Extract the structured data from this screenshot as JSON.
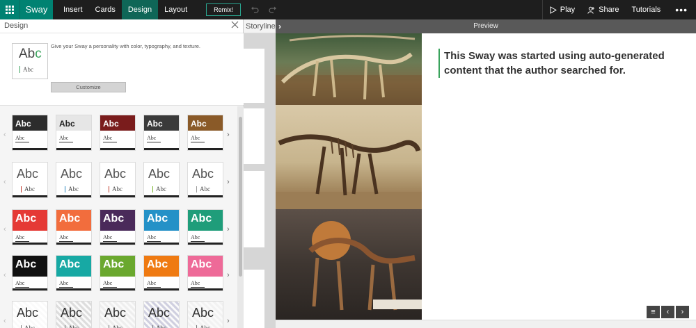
{
  "app": {
    "brand": "Sway",
    "tabs": [
      {
        "label": "Insert"
      },
      {
        "label": "Cards"
      },
      {
        "label": "Design"
      },
      {
        "label": "Layout"
      }
    ],
    "remix_label": "Remix!",
    "play_label": "Play",
    "share_label": "Share",
    "tutorials_label": "Tutorials",
    "more_label": "•••"
  },
  "design_pane": {
    "title": "Design",
    "intro_text": "Give your Sway a personality with color, typography, and texture.",
    "sample_big": "Ab",
    "sample_accent": "c",
    "sample_small": "Abc",
    "customize_label": "Customize",
    "styles": [
      {
        "title": "Abc",
        "subtitle": "Abc"
      }
    ]
  },
  "storyline": {
    "title": "Storyline"
  },
  "preview": {
    "title": "Preview",
    "quote": "This Sway was started using auto-generated content that the author searched for."
  },
  "colors": {
    "accent": "#008272",
    "green_bar": "#3aa35c"
  }
}
